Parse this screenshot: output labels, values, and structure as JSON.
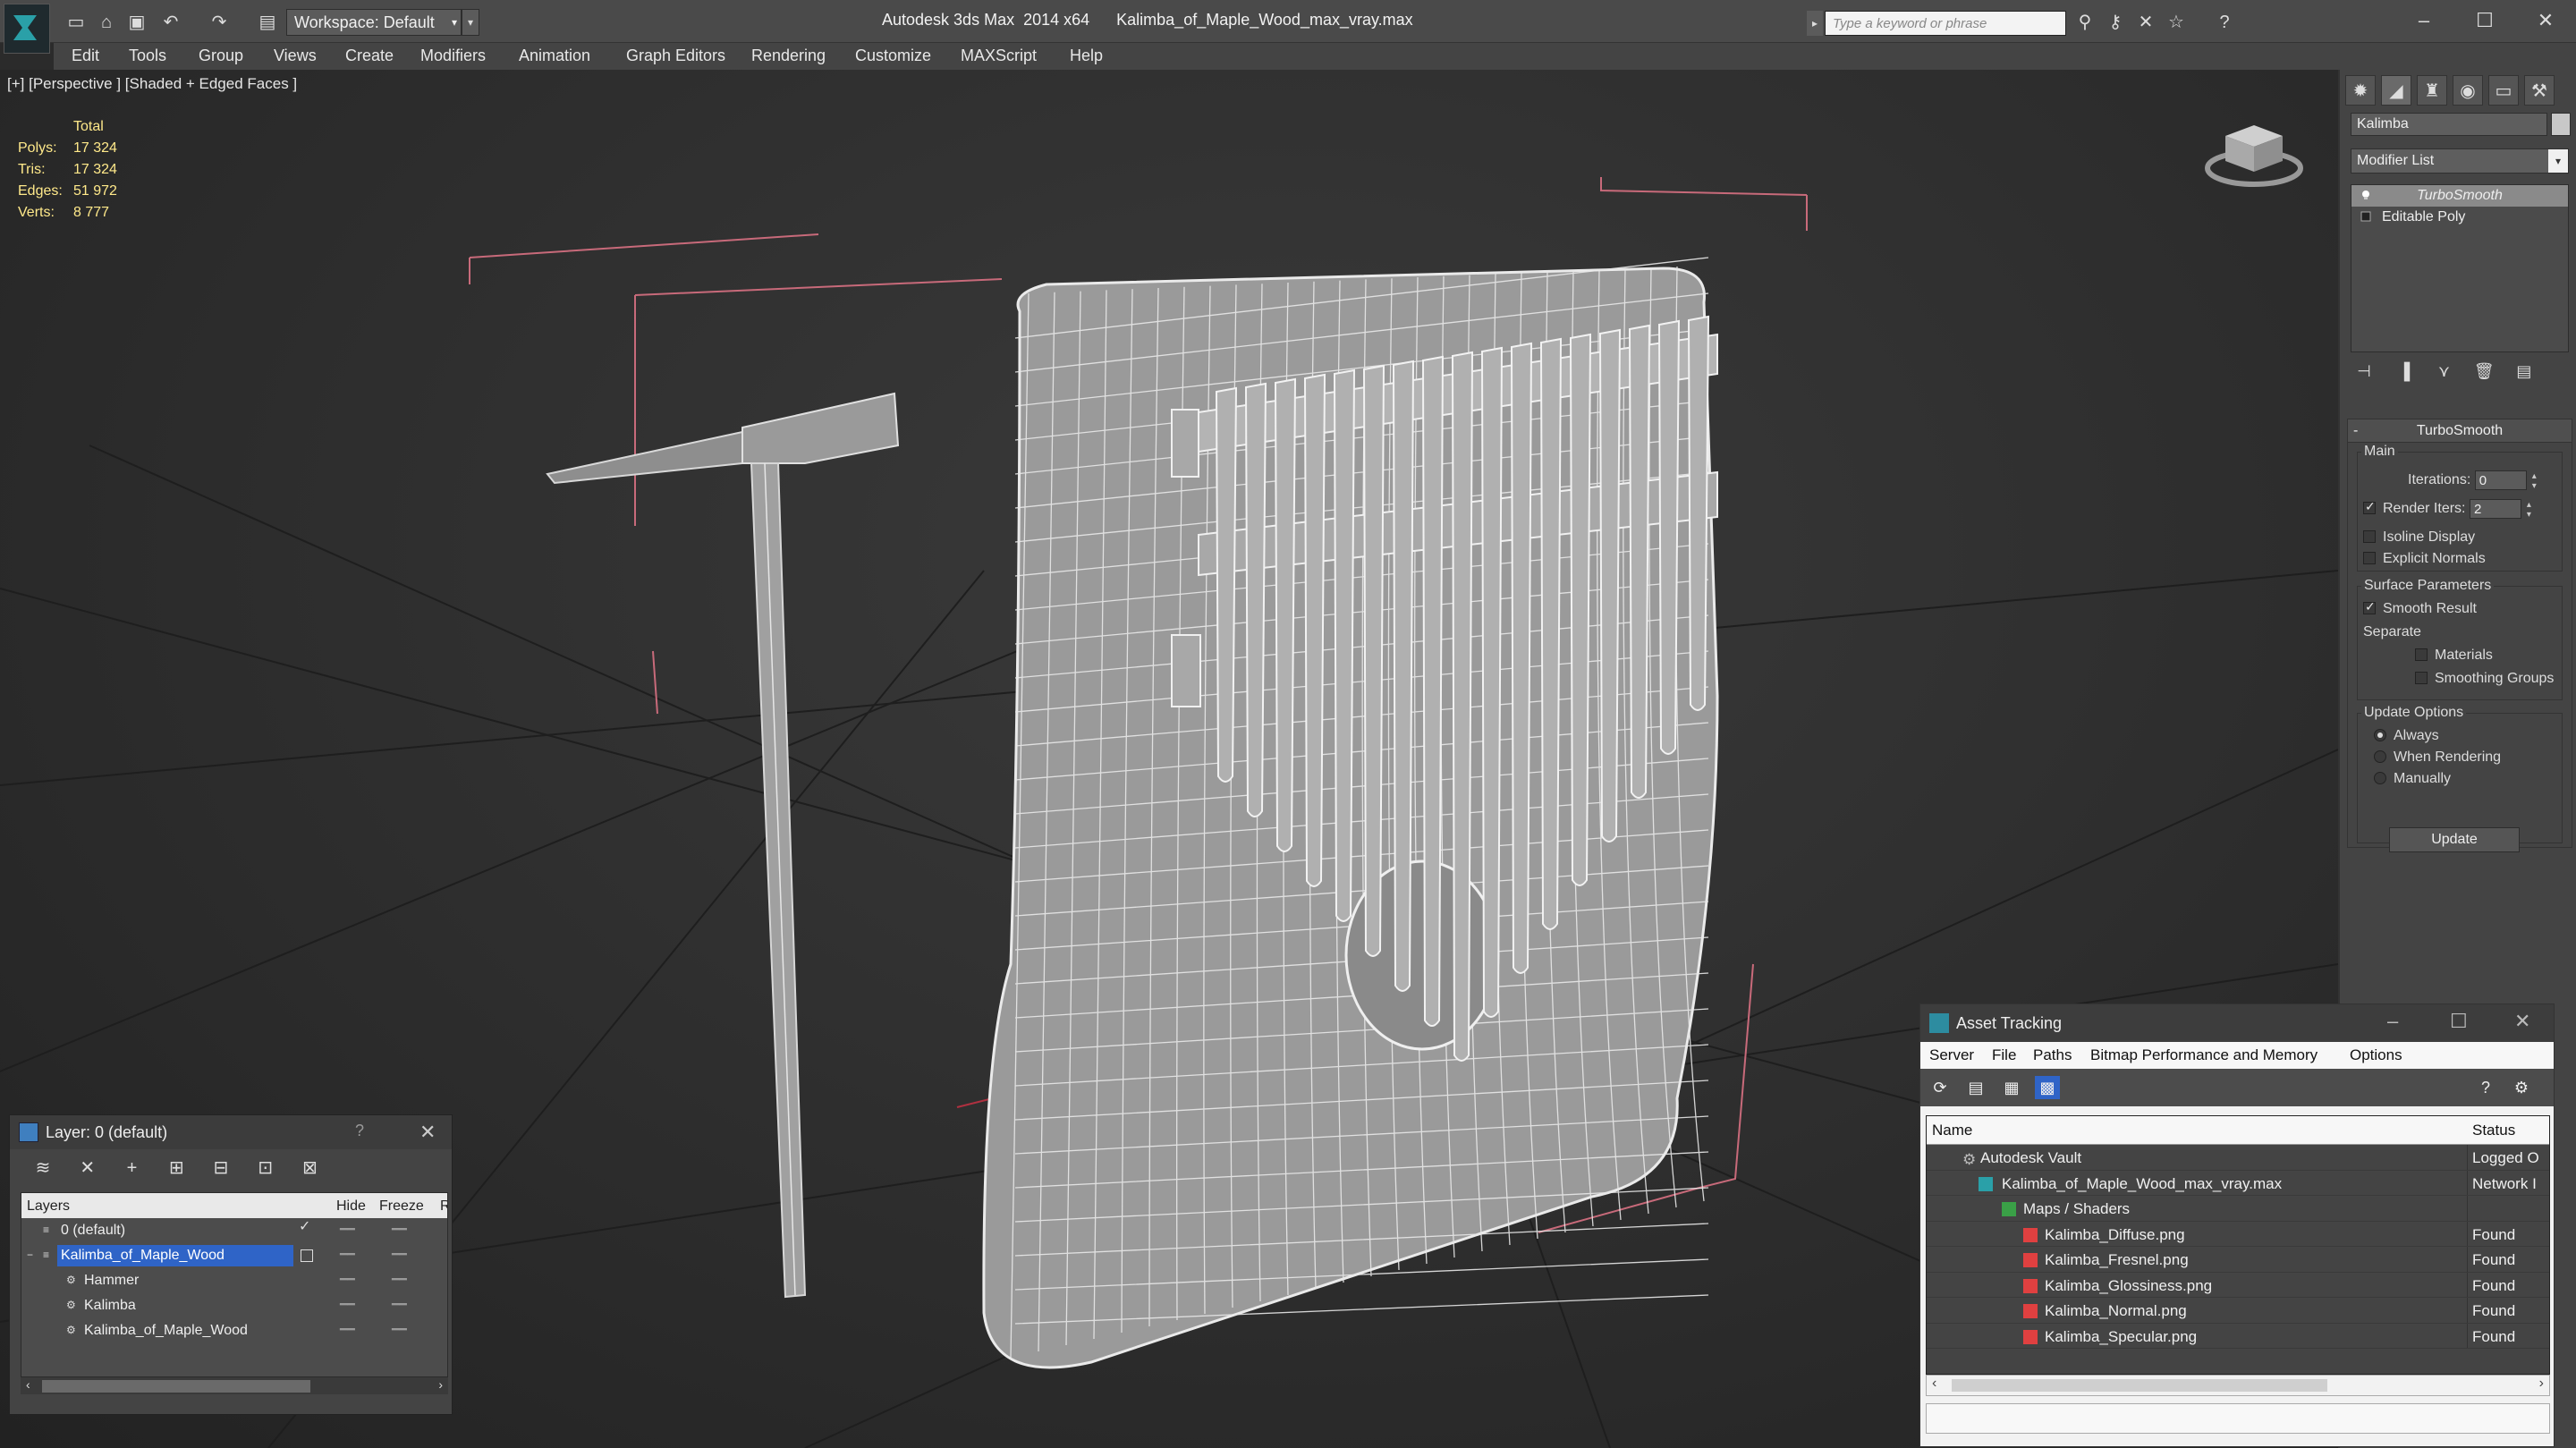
{
  "window": {
    "title": "Autodesk 3ds Max  2014 x64      Kalimba_of_Maple_Wood_max_vray.max",
    "workspace": "Workspace: Default",
    "search_placeholder": "Type a keyword or phrase"
  },
  "menu": [
    "Edit",
    "Tools",
    "Group",
    "Views",
    "Create",
    "Modifiers",
    "Animation",
    "Graph Editors",
    "Rendering",
    "Customize",
    "MAXScript",
    "Help"
  ],
  "viewport": {
    "label": "[+] [Perspective ] [Shaded + Edged Faces ]",
    "stats": {
      "header": "Total",
      "rows": [
        {
          "label": "Polys:",
          "value": "17 324"
        },
        {
          "label": "Tris:",
          "value": "17 324"
        },
        {
          "label": "Edges:",
          "value": "51 972"
        },
        {
          "label": "Verts:",
          "value": "8 777"
        }
      ]
    }
  },
  "command_panel": {
    "object_name": "Kalimba",
    "modifier_list": "Modifier List",
    "stack": [
      "TurboSmooth",
      "Editable Poly"
    ],
    "rollout_title": "TurboSmooth",
    "main_group": "Main",
    "iterations_label": "Iterations:",
    "iterations_value": "0",
    "render_iters_label": "Render Iters:",
    "render_iters_value": "2",
    "isoline": "Isoline Display",
    "explicit_normals": "Explicit Normals",
    "surface_group": "Surface Parameters",
    "smooth_result": "Smooth Result",
    "separate": "Separate",
    "materials": "Materials",
    "smoothing_groups": "Smoothing Groups",
    "update_group": "Update Options",
    "always": "Always",
    "when_rendering": "When Rendering",
    "manually": "Manually",
    "update_button": "Update"
  },
  "layer_dialog": {
    "title": "Layer: 0 (default)",
    "help": "?",
    "columns": {
      "layers": "Layers",
      "hide": "Hide",
      "freeze": "Freeze",
      "render": "R"
    },
    "rows": [
      {
        "name": "0 (default)",
        "indent": 0
      },
      {
        "name": "Kalimba_of_Maple_Wood",
        "indent": 0
      },
      {
        "name": "Hammer",
        "indent": 1
      },
      {
        "name": "Kalimba",
        "indent": 1
      },
      {
        "name": "Kalimba_of_Maple_Wood",
        "indent": 1
      }
    ]
  },
  "asset_dialog": {
    "title": "Asset Tracking",
    "menu": [
      "Server",
      "File",
      "Paths",
      "Bitmap Performance and Memory",
      "Options"
    ],
    "columns": {
      "name": "Name",
      "status": "Status"
    },
    "rows": [
      {
        "name": "Autodesk Vault",
        "status": "Logged O",
        "indent": 1
      },
      {
        "name": "Kalimba_of_Maple_Wood_max_vray.max",
        "status": "Network I",
        "indent": 2
      },
      {
        "name": "Maps / Shaders",
        "status": "",
        "indent": 3
      },
      {
        "name": "Kalimba_Diffuse.png",
        "status": "Found",
        "indent": 4
      },
      {
        "name": "Kalimba_Fresnel.png",
        "status": "Found",
        "indent": 4
      },
      {
        "name": "Kalimba_Glossiness.png",
        "status": "Found",
        "indent": 4
      },
      {
        "name": "Kalimba_Normal.png",
        "status": "Found",
        "indent": 4
      },
      {
        "name": "Kalimba_Specular.png",
        "status": "Found",
        "indent": 4
      }
    ]
  }
}
